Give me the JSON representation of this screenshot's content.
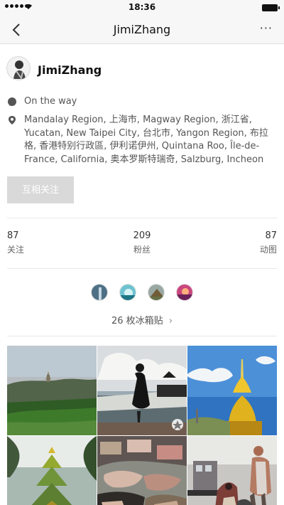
{
  "status_bar": {
    "time": "18:36"
  },
  "nav": {
    "title": "JimiZhang",
    "more": "···"
  },
  "profile": {
    "username": "JimiZhang",
    "status": "On the way",
    "locations": "Mandalay Region, 上海市, Magway Region, 浙江省, Yucatan, New Taipei City, 台北市, Yangon Region, 布拉格, 香港特别行政區, 伊利诺伊州, Quintana Roo, Île-de-France, California, 奥本罗斯特瑞奇, Salzburg, Incheon",
    "mutual_follow": "互相关注"
  },
  "stats": [
    {
      "value": "87",
      "label": "关注"
    },
    {
      "value": "209",
      "label": "粉丝"
    },
    {
      "value": "87",
      "label": "动图"
    }
  ],
  "stickers": {
    "count_label": "26 枚冰箱贴",
    "chevron": "›"
  },
  "photos": [
    {
      "name": "green landscape with pagoda"
    },
    {
      "name": "woman on boat"
    },
    {
      "name": "golden stupa"
    },
    {
      "name": "green temple"
    },
    {
      "name": "market stall"
    },
    {
      "name": "bus and people"
    }
  ]
}
